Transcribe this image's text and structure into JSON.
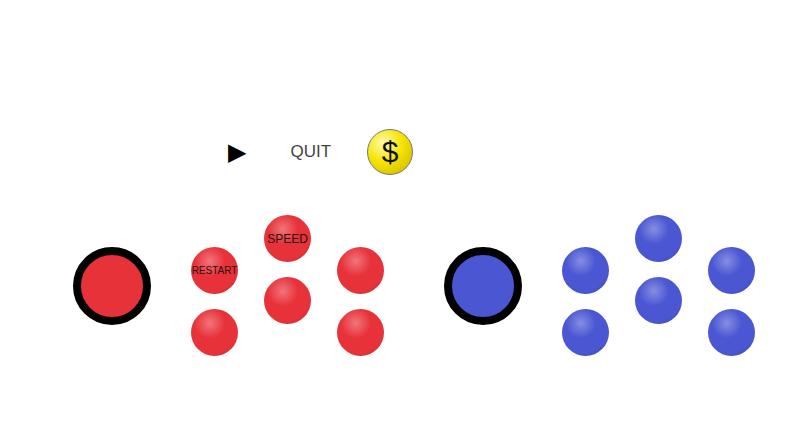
{
  "controls": {
    "play": "▶",
    "quit": "QUIT",
    "coin": "$"
  },
  "pads": [
    {
      "name": "red",
      "color": "#e8323a",
      "buttons": [
        "RESTART",
        "",
        "SPEED",
        "",
        "",
        ""
      ]
    },
    {
      "name": "blue",
      "color": "#4a56d2",
      "buttons": [
        "",
        "",
        "",
        "",
        "",
        ""
      ]
    }
  ]
}
